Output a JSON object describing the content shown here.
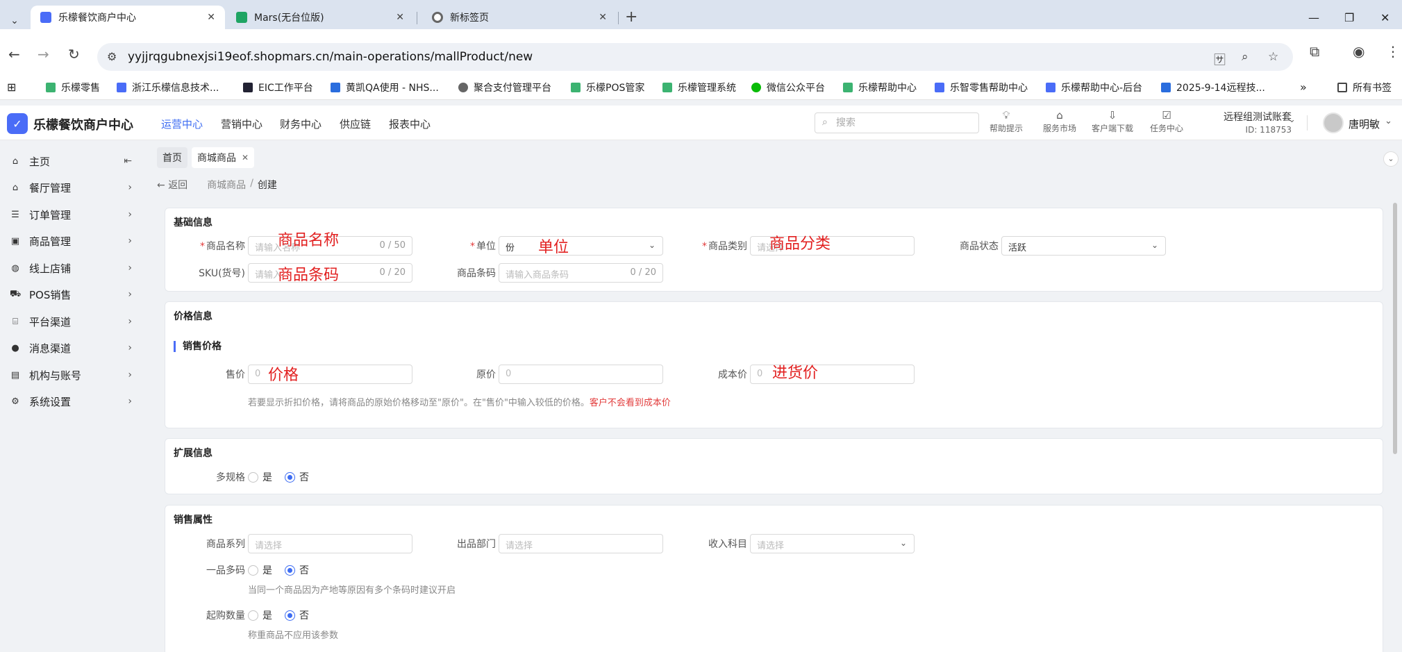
{
  "browser": {
    "tabs": [
      {
        "title": "乐檬餐饮商户中心",
        "close": "✕"
      },
      {
        "title": "Mars(无台位版)",
        "close": "✕"
      },
      {
        "title": "新标签页",
        "close": "✕"
      }
    ],
    "new_tab": "+",
    "url": "yyjjrqgubnexjsi19eof.shopmars.cn/main-operations/mallProduct/new",
    "bookmarks": [
      "乐檬零售",
      "浙江乐檬信息技术...",
      "EIC工作平台",
      "黄凯QA使用 - NHS...",
      "聚合支付管理平台",
      "乐檬POS管家",
      "乐檬管理系统",
      "微信公众平台",
      "乐檬帮助中心",
      "乐智零售帮助中心",
      "乐檬帮助中心-后台",
      "2025-9-14远程技..."
    ],
    "bookmarks_more": "»",
    "all_bookmarks": "所有书签"
  },
  "app": {
    "logo_text": "乐檬餐饮商户中心",
    "nav": [
      "运营中心",
      "营销中心",
      "财务中心",
      "供应链",
      "报表中心"
    ],
    "search_placeholder": "搜索",
    "tools": [
      "帮助提示",
      "服务市场",
      "客户端下载",
      "任务中心"
    ],
    "account_name": "远程组测试账套",
    "account_id": "ID: 118753",
    "user_name": "唐明敏"
  },
  "sidebar": {
    "items": [
      "主页",
      "餐厅管理",
      "订单管理",
      "商品管理",
      "线上店铺",
      "POS销售",
      "平台渠道",
      "消息渠道",
      "机构与账号",
      "系统设置"
    ]
  },
  "page": {
    "tabs": [
      "首页",
      "商城商品"
    ],
    "back": "返回",
    "crumb_parent": "商城商品",
    "crumb_sep": "/",
    "crumb_current": "创建"
  },
  "basic": {
    "title": "基础信息",
    "name_label": "商品名称",
    "name_placeholder": "请输入名称",
    "name_count": "0 / 50",
    "unit_label": "单位",
    "unit_value": "份",
    "category_label": "商品类别",
    "category_placeholder": "请选择",
    "status_label": "商品状态",
    "status_value": "活跃",
    "sku_label": "SKU(货号)",
    "sku_placeholder": "请输入",
    "sku_count": "0 / 20",
    "barcode_label": "商品条码",
    "barcode_placeholder": "请输入商品条码",
    "barcode_count": "0 / 20",
    "required_mark": "*"
  },
  "price": {
    "title": "价格信息",
    "sub_title": "销售价格",
    "sale_label": "售价",
    "sale_placeholder": "0",
    "original_label": "原价",
    "original_placeholder": "0",
    "cost_label": "成本价",
    "cost_placeholder": "0",
    "hint": "若要显示折扣价格，请将商品的原始价格移动至\"原价\"。在\"售价\"中输入较低的价格。",
    "hint_red": "客户不会看到成本价"
  },
  "ext": {
    "title": "扩展信息",
    "multi_spec_label": "多规格",
    "yes": "是",
    "no": "否"
  },
  "sales": {
    "title": "销售属性",
    "series_label": "商品系列",
    "series_placeholder": "请选择",
    "dept_label": "出品部门",
    "dept_placeholder": "请选择",
    "income_label": "收入科目",
    "income_placeholder": "请选择",
    "multi_code_label": "一品多码",
    "multi_code_hint": "当同一个商品因为产地等原因有多个条码时建议开启",
    "min_qty_label": "起购数量",
    "min_qty_hint": "称重商品不应用该参数",
    "yes": "是",
    "no": "否"
  },
  "annotations": {
    "name": "商品名称",
    "unit": "单位",
    "category": "商品分类",
    "barcode": "商品条码",
    "price": "价格",
    "cost": "进货价"
  },
  "colors": {
    "accent": "#3d6cf2",
    "annotation": "#e22020",
    "required": "#e23b3b"
  }
}
